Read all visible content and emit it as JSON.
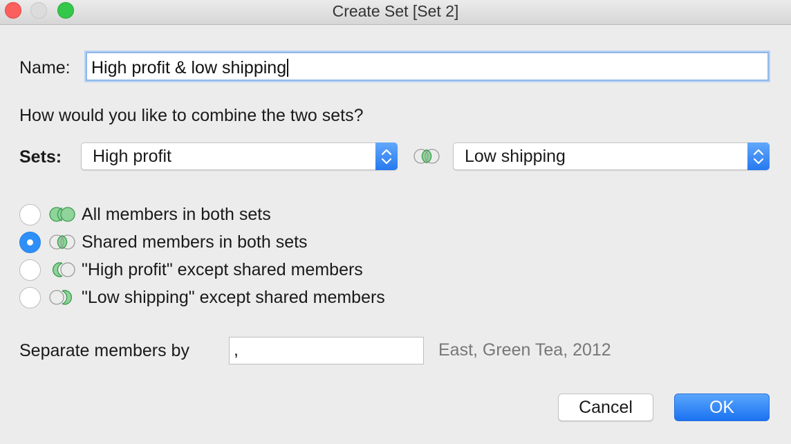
{
  "window": {
    "title": "Create Set [Set 2]"
  },
  "name_field": {
    "label": "Name:",
    "value": "High profit & low shipping"
  },
  "combine": {
    "question": "How would you like to combine the two sets?"
  },
  "sets": {
    "label": "Sets:",
    "left_set": "High profit",
    "right_set": "Low shipping"
  },
  "options": [
    {
      "label": "All members in both sets",
      "selected": false,
      "icon": "venn-all-icon"
    },
    {
      "label": "Shared members in both sets",
      "selected": true,
      "icon": "venn-shared-icon"
    },
    {
      "label": "\"High profit\" except shared members",
      "selected": false,
      "icon": "venn-left-icon"
    },
    {
      "label": "\"Low shipping\" except shared members",
      "selected": false,
      "icon": "venn-right-icon"
    }
  ],
  "separator": {
    "label": "Separate members by",
    "value": ",",
    "example": "East, Green Tea, 2012"
  },
  "buttons": {
    "cancel": "Cancel",
    "ok": "OK"
  },
  "colors": {
    "venn_fill": "#8fd49a",
    "venn_stroke": "#3a9a4d",
    "accent": "#2e8ff8"
  }
}
